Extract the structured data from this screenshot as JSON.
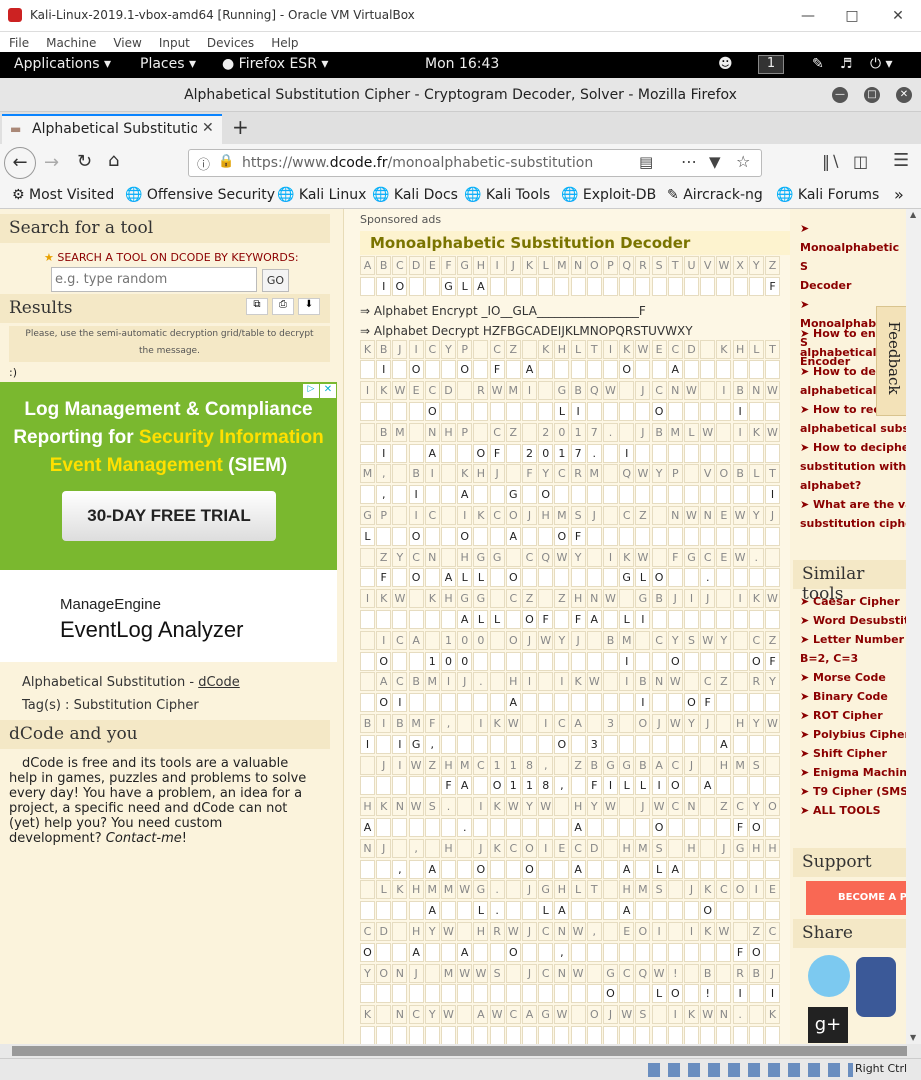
{
  "vbox": {
    "title": "Kali-Linux-2019.1-vbox-amd64 [Running] - Oracle VM VirtualBox",
    "menu": [
      "File",
      "Machine",
      "View",
      "Input",
      "Devices",
      "Help"
    ],
    "host_key": "Right Ctrl"
  },
  "gnome": {
    "applications": "Applications",
    "places": "Places",
    "firefox": "Firefox ESR",
    "clock": "Mon 16:43",
    "workspace": "1"
  },
  "firefox": {
    "title": "Alphabetical Substitution Cipher - Cryptogram Decoder, Solver - Mozilla Firefox",
    "tab_label": "Alphabetical Substitution",
    "url_prefix": "https://www.",
    "url_domain": "dcode.fr",
    "url_path": "/monoalphabetic-substitution",
    "bookmarks": [
      "Most Visited",
      "Offensive Security",
      "Kali Linux",
      "Kali Docs",
      "Kali Tools",
      "Exploit-DB",
      "Aircrack-ng",
      "Kali Forums"
    ]
  },
  "left": {
    "search_heading": "Search for a tool",
    "search_label": "SEARCH A TOOL ON DCODE BY KEYWORDS:",
    "search_placeholder": "e.g. type random",
    "go": "GO",
    "results_heading": "Results",
    "results_msg": "Please, use the semi-automatic decryption grid/table to decrypt the message.",
    "smiley": ":)",
    "ad": {
      "line1": "Log Management & Compliance",
      "line2a": "Reporting for ",
      "line2b": "Security Information",
      "line3a": "Event Management",
      "line3b": " (SIEM)",
      "cta": "30-DAY FREE TRIAL",
      "brand1": "ManageEngine",
      "brand2": "EventLog Analyzer"
    },
    "crumb": "Alphabetical Substitution - ",
    "crumb_link": "dCode",
    "tags": "Tag(s) : Substitution Cipher",
    "you_heading": "dCode and you",
    "you_text": "dCode is free and its tools are a valuable help in games, puzzles and problems to solve every day! You have a problem, an idea for a project, a specific need and dCode can not (yet) help you? You need custom development? ",
    "contact": "Contact-me",
    "bang": "!"
  },
  "mid": {
    "sponsored": "Sponsored ads",
    "heading": "Monoalphabetic Substitution Decoder",
    "encrypt": "⇒ Alphabet Encrypt _IO__GLA_________________F",
    "decrypt": "⇒ Alphabet Decrypt HZFBGCADEIJKLMNOPQRSTUVWXY",
    "grid": [
      "ABCDEFGHIJKLMNOPQRSTUVWXYZ",
      "_IO__GLA_________________F",
      "KBJICYP_CZ_KHLTIKWECD_KHLT",
      "_I_O__O_F_A_____O__A_",
      "IKWECD_RWMI_GBQW_JCNW_IBNW",
      "____O_______LI____O____I",
      "_BM_NHP_CZ_2017._JBMLW_IKW",
      "_I__A__OF_2017._I",
      "M,_BI_KHJ_FYCRM_QWYP_VOBLT",
      "_,_I__A__G_O_____________I",
      "GP_IC_IKCOJHMSJ_CZ_NWNEWYJ",
      "L__O__O__A__OF",
      "_ZYCN_HGG_CQWY_IKW_FGCEW.",
      "_F_O_ALL_O______GLO__.",
      "IKW_KHGG_CZ_ZHNW_GBJIJ_IKW",
      "______ALL_OF_FA_LI",
      "_ICA_100_OJWYJ_BM_CYSWY_CZ",
      "_O__100_________I__O____OF",
      "_ACBMIJ._HI_IKW_IBNW_CZ_RY",
      "_OI______A_______I__OF",
      "BIBMF,_IKW_ICA_3_OJWYJ_HYW",
      "I_IG,_______O_3_______A",
      "_JIWZHMC118,_ZBGGBACJ_HMS",
      "_____FA_O118,_FILLIO_A",
      "HKNWS._IKWYW_HYW_JWCN_ZCYO",
      "A_____.______A____O____FO",
      "NJ_,_H_JKCOIECD_HMS_H_JGHHT",
      "__,_A__O__O__A__A_LA",
      "_LKHMMWG._JGHLT_HMS_JKCOIE",
      "____A__L.__LA___A____O",
      "CD_HYW_HRWJCNW,_EOI_IKW_ZC",
      "O__A__A__O__,__________FO",
      "YONJ_MWWS_JCNW_GCQW!_B_RBJ",
      "_______________O__LO_!_I_I",
      "K_NCYW_AWCAGW_OJWS_IKWN._K",
      "________________________"
    ]
  },
  "right": {
    "top_links": [
      "Monoalphabetic S",
      "Decoder",
      "Monoalphabetic S",
      "Encoder"
    ],
    "faq": [
      "How to enc",
      "alphabetical su",
      "How to dec",
      "alphabetical su",
      "How to reco",
      "alphabetical substitu",
      "How to decipher a",
      "substitution without",
      "alphabet?",
      "What are the varia",
      "substitution cipher?"
    ],
    "similar_heading": "Similar tools",
    "similar": [
      "Caesar Cipher",
      "Word Desubstitut",
      "Letter Number (A",
      "B=2, C=3",
      "Morse Code",
      "Binary Code",
      "ROT Cipher",
      "Polybius Cipher",
      "Shift Cipher",
      "Enigma Machine",
      "T9 Cipher (SMS)",
      "ALL TOOLS"
    ],
    "support_heading": "Support",
    "support_btn": "BECOME A P",
    "share_heading": "Share",
    "feedback": "Feedback"
  }
}
